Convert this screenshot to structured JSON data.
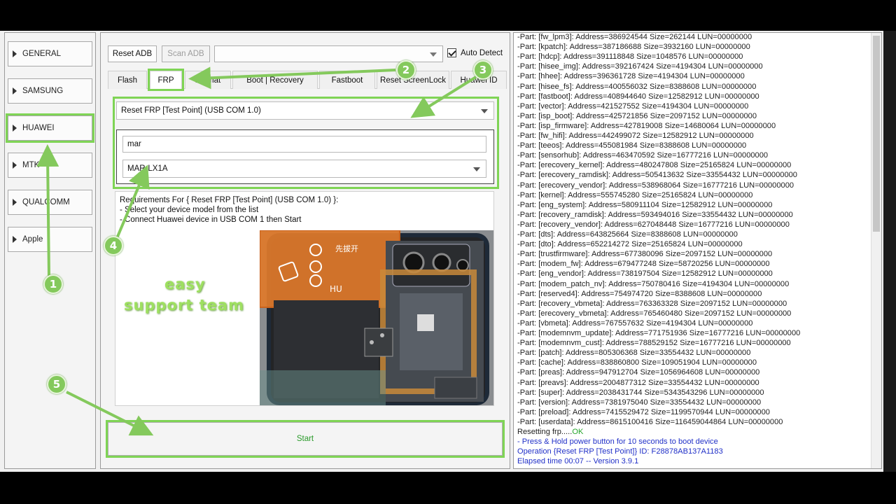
{
  "nav": {
    "items": [
      {
        "label": "GENERAL"
      },
      {
        "label": "SAMSUNG"
      },
      {
        "label": "HUAWEI"
      },
      {
        "label": "MTK"
      },
      {
        "label": "QUALCOMM"
      },
      {
        "label": "Apple"
      }
    ],
    "active": "HUAWEI"
  },
  "toolbar": {
    "reset_adb": "Reset ADB",
    "scan_adb": "Scan ADB",
    "port_combo_value": "",
    "auto_detect": "Auto Detect",
    "auto_detect_checked": true
  },
  "tabs": [
    {
      "label": "Flash"
    },
    {
      "label": "FRP"
    },
    {
      "label": "Format"
    },
    {
      "label": "Boot | Recovery"
    },
    {
      "label": "Fastboot"
    },
    {
      "label": "Reset ScreenLock"
    },
    {
      "label": "Huawei ID"
    }
  ],
  "frp": {
    "operation": "Reset FRP [Test Point] (USB COM 1.0)",
    "search_value": "mar",
    "model": "MAR-LX1A"
  },
  "requirements": {
    "line1": "Requirements For { Reset FRP [Test Point] (USB COM 1.0) }:",
    "line2": "- Select your device model from the list",
    "line3": "- Connect Huawei device in USB COM 1 then Start"
  },
  "watermark": {
    "line1": "easy",
    "line2": "support  team"
  },
  "phone_labels": {
    "l1": "先拔开",
    "l2": "HU"
  },
  "start_label": "Start",
  "log": {
    "parts": [
      "-Part: [fw_lpm3]: Address=386924544 Size=262144 LUN=00000000",
      "-Part: [kpatch]: Address=387186688 Size=3932160 LUN=00000000",
      "-Part: [hdcp]: Address=391118848 Size=1048576 LUN=00000000",
      "-Part: [hisee_img]: Address=392167424 Size=4194304 LUN=00000000",
      "-Part: [hhee]: Address=396361728 Size=4194304 LUN=00000000",
      "-Part: [hisee_fs]: Address=400556032 Size=8388608 LUN=00000000",
      "-Part: [fastboot]: Address=408944640 Size=12582912 LUN=00000000",
      "-Part: [vector]: Address=421527552 Size=4194304 LUN=00000000",
      "-Part: [isp_boot]: Address=425721856 Size=2097152 LUN=00000000",
      "-Part: [isp_firmware]: Address=427819008 Size=14680064 LUN=00000000",
      "-Part: [fw_hifi]: Address=442499072 Size=12582912 LUN=00000000",
      "-Part: [teeos]: Address=455081984 Size=8388608 LUN=00000000",
      "-Part: [sensorhub]: Address=463470592 Size=16777216 LUN=00000000",
      "-Part: [erecovery_kernel]: Address=480247808 Size=25165824 LUN=00000000",
      "-Part: [erecovery_ramdisk]: Address=505413632 Size=33554432 LUN=00000000",
      "-Part: [erecovery_vendor]: Address=538968064 Size=16777216 LUN=00000000",
      "-Part: [kernel]: Address=555745280 Size=25165824 LUN=00000000",
      "-Part: [eng_system]: Address=580911104 Size=12582912 LUN=00000000",
      "-Part: [recovery_ramdisk]: Address=593494016 Size=33554432 LUN=00000000",
      "-Part: [recovery_vendor]: Address=627048448 Size=16777216 LUN=00000000",
      "-Part: [dts]: Address=643825664 Size=8388608 LUN=00000000",
      "-Part: [dto]: Address=652214272 Size=25165824 LUN=00000000",
      "-Part: [trustfirmware]: Address=677380096 Size=2097152 LUN=00000000",
      "-Part: [modem_fw]: Address=679477248 Size=58720256 LUN=00000000",
      "-Part: [eng_vendor]: Address=738197504 Size=12582912 LUN=00000000",
      "-Part: [modem_patch_nv]: Address=750780416 Size=4194304 LUN=00000000",
      "-Part: [reserved4]: Address=754974720 Size=8388608 LUN=00000000",
      "-Part: [recovery_vbmeta]: Address=763363328 Size=2097152 LUN=00000000",
      "-Part: [erecovery_vbmeta]: Address=765460480 Size=2097152 LUN=00000000",
      "-Part: [vbmeta]: Address=767557632 Size=4194304 LUN=00000000",
      "-Part: [modemnvm_update]: Address=771751936 Size=16777216 LUN=00000000",
      "-Part: [modemnvm_cust]: Address=788529152 Size=16777216 LUN=00000000",
      "-Part: [patch]: Address=805306368 Size=33554432 LUN=00000000",
      "-Part: [cache]: Address=838860800 Size=109051904 LUN=00000000",
      "-Part: [preas]: Address=947912704 Size=1056964608 LUN=00000000",
      "-Part: [preavs]: Address=2004877312 Size=33554432 LUN=00000000",
      "-Part: [super]: Address=2038431744 Size=5343543296 LUN=00000000",
      "-Part: [version]: Address=7381975040 Size=33554432 LUN=00000000",
      "-Part: [preload]: Address=7415529472 Size=1199570944 LUN=00000000",
      "-Part: [userdata]: Address=8615100416 Size=116459044864 LUN=00000000"
    ],
    "resetting": "Resetting frp.....",
    "resetting_ok": "OK",
    "press_hold": "- Press & Hold power button for 10 seconds to boot device",
    "operation": "Operation {Reset FRP [Test Point]} ID: F28878AB137A1183",
    "elapsed": "Elapsed time 00:07 -- Version 3.9.1"
  },
  "badges": {
    "b1": "1",
    "b2": "2",
    "b3": "3",
    "b4": "4",
    "b5": "5"
  },
  "colors": {
    "highlight": "#7fd455",
    "badge": "#84c95c",
    "log_blue": "#2130c8",
    "ok_green": "#24a52a"
  }
}
